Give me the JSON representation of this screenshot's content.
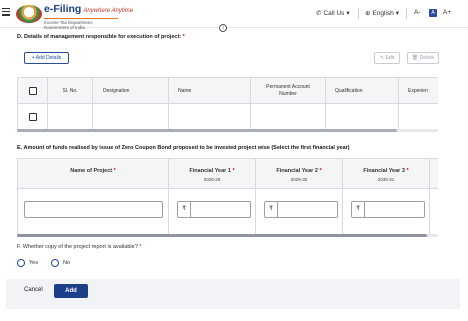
{
  "header": {
    "brand_title": "e-Filing",
    "brand_tagline": "Anywhere Anytime",
    "brand_sub": "Income Tax Department, Government of India",
    "call_us": "Call Us",
    "language": "English",
    "font_decrease": "A-",
    "contrast": "A",
    "font_increase": "A+"
  },
  "section_d": {
    "title": "D. Details of management responsible for execution of project:",
    "required_mark": "*",
    "add_details": "+ Add Details",
    "edit": "Edit",
    "delete": "Delete",
    "columns": [
      "Sl. No.",
      "Designation",
      "Name",
      "Permanent Account Number",
      "Qualification",
      "Experien"
    ]
  },
  "section_e": {
    "title": "E. Amount of funds realised by issue of Zero Coupon Bond proposed to be invested project wise (Select the first financial year)",
    "col_name": "Name of Project",
    "years": [
      {
        "label": "Financial Year 1",
        "range": "2028-29"
      },
      {
        "label": "Financial Year 2",
        "range": "2029-30"
      },
      {
        "label": "Financial Year 3",
        "range": "2030-31"
      }
    ],
    "currency": "₹"
  },
  "section_f": {
    "question": "F. Whether copy of the project report is available?",
    "required_mark": "*",
    "yes": "Yes",
    "no": "No"
  },
  "footer": {
    "cancel": "Cancel",
    "add": "Add"
  }
}
